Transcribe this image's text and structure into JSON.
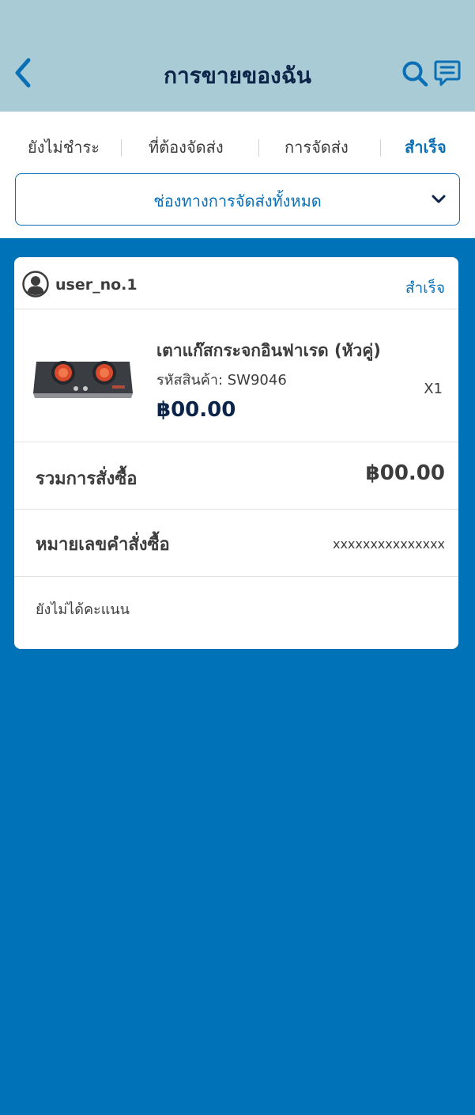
{
  "header": {
    "title": "การขายของฉัน",
    "background": "#a8cbd6"
  },
  "tabs": [
    {
      "label": "ยังไม่ชำระ",
      "active": false
    },
    {
      "label": "ที่ต้องจัดส่ง",
      "active": false
    },
    {
      "label": "การจัดส่ง",
      "active": false
    },
    {
      "label": "สำเร็จ",
      "active": true
    }
  ],
  "shipping_filter": {
    "selected": "ช่องทางการจัดส่งทั้งหมด"
  },
  "order": {
    "username": "user_no.1",
    "status": "สำเร็จ",
    "product": {
      "name": "เตาแก๊สกระจกอินฟาเรด (หัวคู่)",
      "sku": "รหัสสินค้า: SW9046",
      "price": "฿00.00",
      "quantity": "X1"
    },
    "total_label": "รวมการสั่งซื้อ",
    "total_value": "฿00.00",
    "order_number_label": "หมายเลขคำสั่งซื้อ",
    "order_number_value": "xxxxxxxxxxxxxxx",
    "rating_text": "ยังไม่ได้คะแนน"
  },
  "colors": {
    "accent": "#0a6fb5",
    "page_background": "#0073b8",
    "title": "#0b2447"
  }
}
